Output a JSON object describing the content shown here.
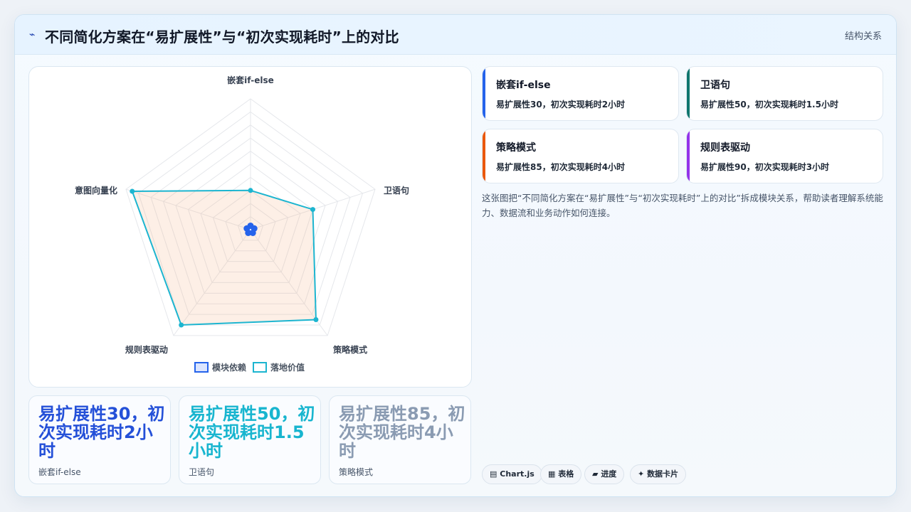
{
  "header": {
    "title": "不同简化方案在“易扩展性”与“初次实现耗时”上的对比",
    "tag": "结构关系"
  },
  "chart_data": {
    "type": "radar",
    "axes": [
      "嵌套if-else",
      "卫语句",
      "策略模式",
      "规则表驱动",
      "意图向量化"
    ],
    "r_max": 100,
    "gridlines": true,
    "legend_position": "bottom",
    "series": [
      {
        "name": "模块依赖",
        "values": [
          3,
          3,
          3,
          3,
          3
        ],
        "color": "#2563eb",
        "fill": "#dbe5ff"
      },
      {
        "name": "落地价值",
        "values": [
          30,
          50,
          85,
          90,
          95
        ],
        "color": "#1cb5d0",
        "fill": "rgba(246,180,140,0.22)"
      }
    ]
  },
  "stats": [
    {
      "value": "易扩展性30，初次实现耗时2小时",
      "label": "嵌套if-else",
      "color": "#2450d8"
    },
    {
      "value": "易扩展性50，初次实现耗时1.5小时",
      "label": "卫语句",
      "color": "#18b5cf"
    },
    {
      "value": "易扩展性85，初次实现耗时4小时",
      "label": "策略模式",
      "color": "#8a9bb2"
    }
  ],
  "options": [
    {
      "name": "嵌套if-else",
      "desc": "易扩展性30，初次实现耗时2小时",
      "color": "#2563eb"
    },
    {
      "name": "卫语句",
      "desc": "易扩展性50，初次实现耗时1.5小时",
      "color": "#0f766e"
    },
    {
      "name": "策略模式",
      "desc": "易扩展性85，初次实现耗时4小时",
      "color": "#ea580c"
    },
    {
      "name": "规则表驱动",
      "desc": "易扩展性90，初次实现耗时3小时",
      "color": "#9333ea"
    }
  ],
  "summary": "这张图把“不同简化方案在“易扩展性”与“初次实现耗时”上的对比”拆成模块关系，帮助读者理解系统能力、数据流和业务动作如何连接。",
  "chips": [
    {
      "icon": "▤",
      "label": "Chart.js"
    },
    {
      "icon": "▦",
      "label": "表格"
    },
    {
      "icon": "▰",
      "label": "进度"
    },
    {
      "icon": "✦",
      "label": "数据卡片"
    }
  ]
}
